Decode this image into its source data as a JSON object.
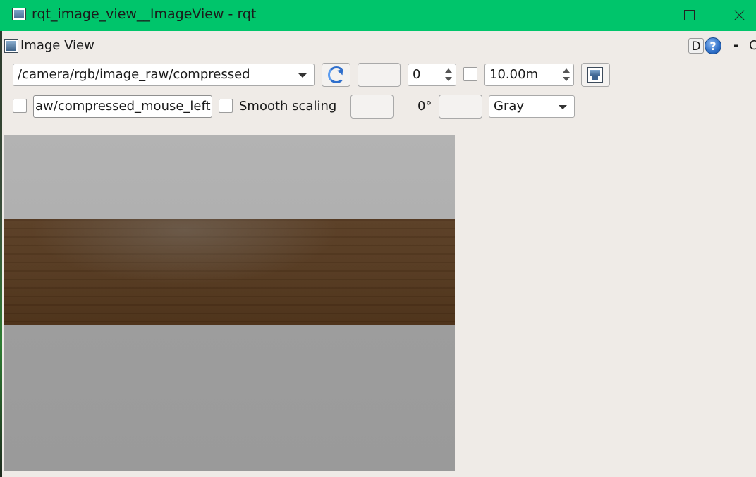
{
  "window": {
    "title": "rqt_image_view__ImageView - rqt"
  },
  "plugin": {
    "title": "Image View",
    "d_label": "D",
    "help_label": "?",
    "minimize_label": "-",
    "close_label": "C"
  },
  "toolbar": {
    "topic": "/camera/rgb/image_raw/compressed",
    "spin_value": "0",
    "max_value": "10.00m",
    "mouse_topic": "aw/compressed_mouse_left",
    "smooth_label": "Smooth scaling",
    "rotation": "0°",
    "color_scheme": "Gray"
  },
  "image": {
    "band_colors": [
      "#b2b2b2",
      "#553920",
      "#9c9c9c"
    ]
  }
}
